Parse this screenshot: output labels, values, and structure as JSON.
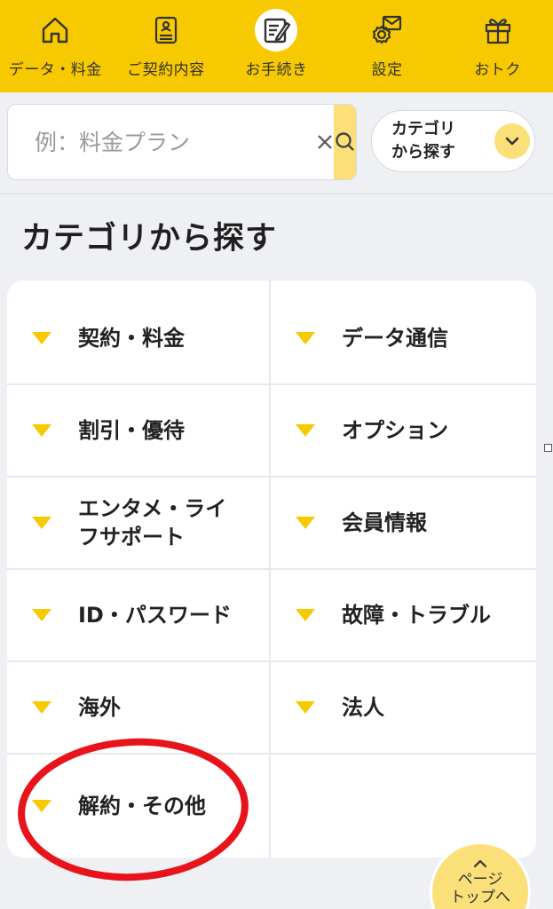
{
  "nav": {
    "items": [
      {
        "label": "データ・料金",
        "icon": "home-icon",
        "active": false
      },
      {
        "label": "ご契約内容",
        "icon": "contract-document-icon",
        "active": false
      },
      {
        "label": "お手続き",
        "icon": "notepad-pen-icon",
        "active": true
      },
      {
        "label": "設定",
        "icon": "settings-gear-mail-icon",
        "active": false
      },
      {
        "label": "おトク",
        "icon": "gift-icon",
        "active": false
      }
    ]
  },
  "search": {
    "placeholder": "例：料金プラン",
    "clear_icon": "close-icon",
    "search_icon": "search-icon"
  },
  "category_button": {
    "label": "カテゴリ\nから探す",
    "icon": "chevron-down-icon"
  },
  "section_title": "カテゴリから探す",
  "categories": [
    "契約・料金",
    "データ通信",
    "割引・優待",
    "オプション",
    "エンタメ・ライ\nフサポート",
    "会員情報",
    "ID・パスワード",
    "故障・トラブル",
    "海外",
    "法人",
    "解約・その他",
    ""
  ],
  "annotation": {
    "color": "#e8141b",
    "target": "解約・その他"
  },
  "page_top": {
    "label": "ページ\nトップへ",
    "icon": "chevron-up-icon"
  },
  "colors": {
    "brand_yellow": "#f7c900",
    "light_yellow": "#fbe07a",
    "background": "#eef0f3"
  }
}
